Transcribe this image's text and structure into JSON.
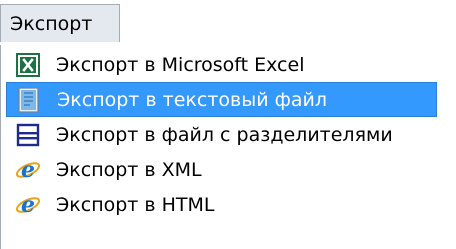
{
  "menubar": {
    "export_label": "Экспорт"
  },
  "menu": {
    "items": [
      {
        "label": "Экспорт в Microsoft Excel",
        "icon": "excel-icon",
        "highlighted": false
      },
      {
        "label": "Экспорт в текстовый файл",
        "icon": "text-file-icon",
        "highlighted": true
      },
      {
        "label": "Экспорт в файл с разделителями",
        "icon": "delimited-file-icon",
        "highlighted": false
      },
      {
        "label": "Экспорт в XML",
        "icon": "internet-explorer-icon",
        "highlighted": false
      },
      {
        "label": "Экспорт в HTML",
        "icon": "internet-explorer-icon",
        "highlighted": false
      }
    ]
  },
  "colors": {
    "highlight": "#3399ff",
    "menubar_bg": "#e4e9ef",
    "excel_green": "#1e7145",
    "delimiter_blue": "#1f2a8f",
    "ie_blue": "#1a73c9"
  }
}
